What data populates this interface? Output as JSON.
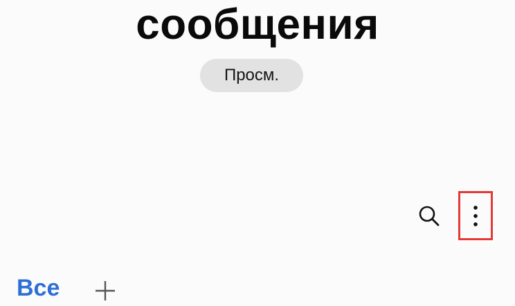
{
  "header": {
    "title": "сообщения",
    "view_button_label": "Просм."
  },
  "toolbar": {
    "search_icon": "search-icon",
    "more_icon": "more-vertical-icon",
    "highlight_color": "#e53935"
  },
  "tabs": {
    "active_label": "Все",
    "active_color": "#2e6fd6",
    "add_icon": "plus-icon"
  }
}
